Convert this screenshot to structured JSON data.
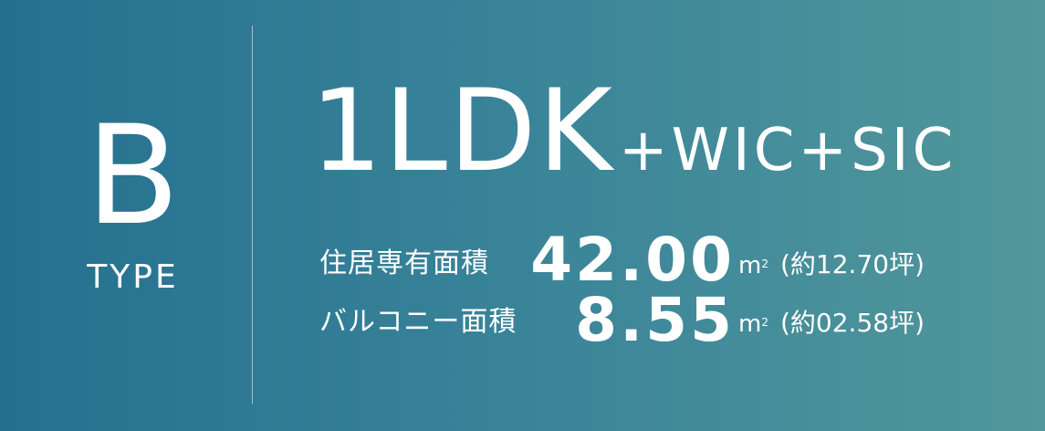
{
  "type": {
    "letter": "B",
    "label": "TYPE"
  },
  "plan": {
    "layout": "1LDK",
    "options": "+WIC+SIC"
  },
  "areas": [
    {
      "label": "住居専有面積",
      "value": "42.00",
      "unit": "m",
      "unit_sup": "2",
      "tsubo": "(約12.70坪)"
    },
    {
      "label": "バルコニー面積",
      "value": "8.55",
      "unit": "m",
      "unit_sup": "2",
      "tsubo": "(約02.58坪)"
    }
  ],
  "colors": {
    "gradient_start": "#24708f",
    "gradient_end": "#51979b",
    "text": "#ffffff"
  }
}
